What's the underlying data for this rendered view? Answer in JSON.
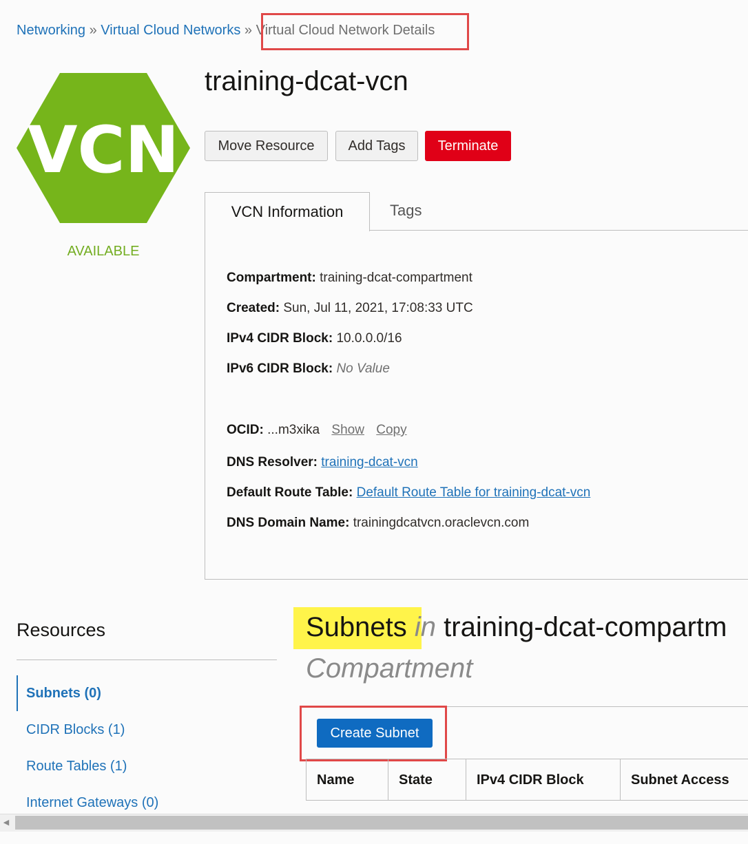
{
  "breadcrumb": {
    "networking": "Networking",
    "separator1": "»",
    "vcns": "Virtual Cloud Networks",
    "separator2": "»",
    "current": "Virtual Cloud Network Details"
  },
  "resource": {
    "icon_text": "VCN",
    "status": "AVAILABLE",
    "name": "training-dcat-vcn",
    "colors": {
      "icon": "#76b51b",
      "status": "#73ad21",
      "danger": "#e00017",
      "link": "#1f72b8",
      "highlight": "#fff44a",
      "annotation": "#e04848"
    }
  },
  "actions": {
    "move": "Move Resource",
    "add_tags": "Add Tags",
    "terminate": "Terminate"
  },
  "tabs": {
    "vcn_info": "VCN Information",
    "tags": "Tags"
  },
  "info": {
    "compartment_label": "Compartment:",
    "compartment_value": "training-dcat-compartment",
    "created_label": "Created:",
    "created_value": "Sun, Jul 11, 2021, 17:08:33 UTC",
    "ipv4_label": "IPv4 CIDR Block:",
    "ipv4_value": "10.0.0.0/16",
    "ipv6_label": "IPv6 CIDR Block:",
    "ipv6_value": "No Value",
    "ocid_label": "OCID:",
    "ocid_value": "...m3xika",
    "ocid_show": "Show",
    "ocid_copy": "Copy",
    "dns_resolver_label": "DNS Resolver:",
    "dns_resolver_value": "training-dcat-vcn",
    "route_table_label": "Default Route Table:",
    "route_table_value": "Default Route Table for training-dcat-vcn",
    "dns_domain_label": "DNS Domain Name:",
    "dns_domain_value": "trainingdcatvcn.oraclevcn.com"
  },
  "resources": {
    "title": "Resources",
    "items": [
      {
        "label": "Subnets (0)"
      },
      {
        "label": "CIDR Blocks (1)"
      },
      {
        "label": "Route Tables (1)"
      },
      {
        "label": "Internet Gateways (0)"
      }
    ]
  },
  "subnets": {
    "heading": "Subnets",
    "in": "in",
    "compartment": "training-dcat-compartm",
    "compartment_suffix": "Compartment",
    "create_button": "Create Subnet",
    "columns": [
      "Name",
      "State",
      "IPv4 CIDR Block",
      "Subnet Access"
    ]
  },
  "scrollbar": {
    "left_arrow_icon": "triangle-left"
  }
}
